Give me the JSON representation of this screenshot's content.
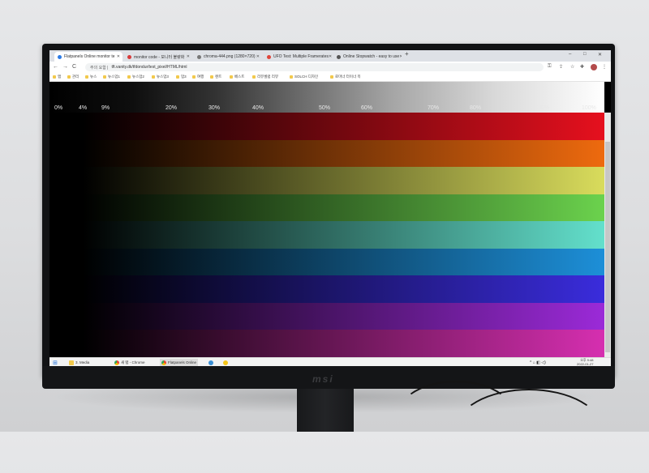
{
  "browser": {
    "tabs": [
      {
        "title": "Flatpanels Online monitor te",
        "fav": "#2c7be5",
        "active": true
      },
      {
        "title": "monitor code - 모니터 불량화",
        "fav": "#d83b3b",
        "active": false
      },
      {
        "title": "chroma-444.png (1280×720)",
        "fav": "#777777",
        "active": false
      },
      {
        "title": "UFO Test: Multiple Framerates",
        "fav": "#e0453a",
        "active": false
      },
      {
        "title": "Online Stopwatch - easy to use",
        "fav": "#555555",
        "active": false
      }
    ],
    "new_tab": "+",
    "window_controls": [
      "–",
      "□",
      "✕"
    ],
    "nav": {
      "back": "←",
      "forward": "→",
      "reload": "C"
    },
    "address": {
      "scheme": "주의 요함 |",
      "url": "tft.vanity.dk/tfdondur/test_pixel/HTML/html"
    },
    "toolbar_icons": [
      "key-icon",
      "share-icon",
      "star-icon",
      "extension-icon"
    ],
    "bookmarks": [
      "앱",
      "관리",
      "뉴스",
      "뉴스업1",
      "뉴스업2",
      "뉴스업3",
      "업3",
      "여행",
      "렌트",
      "베스트",
      "리뷰셀럽 리뷰",
      "SOLCH 디자인",
      "로마너 터이너 목"
    ]
  },
  "page": {
    "percent_labels": [
      "0%",
      "4%",
      "9%",
      "20%",
      "30%",
      "40%",
      "50%",
      "60%",
      "70%",
      "80%",
      "90%",
      "100%"
    ],
    "bars": [
      "#e6101e",
      "#ee6a0e",
      "#d9dc5c",
      "#6bd24d",
      "#63e0cc",
      "#1d8fd8",
      "#3a2cdc",
      "#9b2ad8",
      "#d62fb0"
    ]
  },
  "taskbar": {
    "start_icon": "windows-icon",
    "items": [
      {
        "label": "3. Media",
        "color": "#f2c94c"
      },
      {
        "label": "새 탭 - Chrome",
        "color": "#2c7be5"
      },
      {
        "label": "Flatpanels Online",
        "color": "#2c7be5"
      },
      {
        "label": "",
        "color": "#3a8fd6"
      },
      {
        "label": "",
        "color": "#f5c518"
      }
    ],
    "clock_time": "오후 9:48",
    "clock_date": "2022-01-27"
  }
}
